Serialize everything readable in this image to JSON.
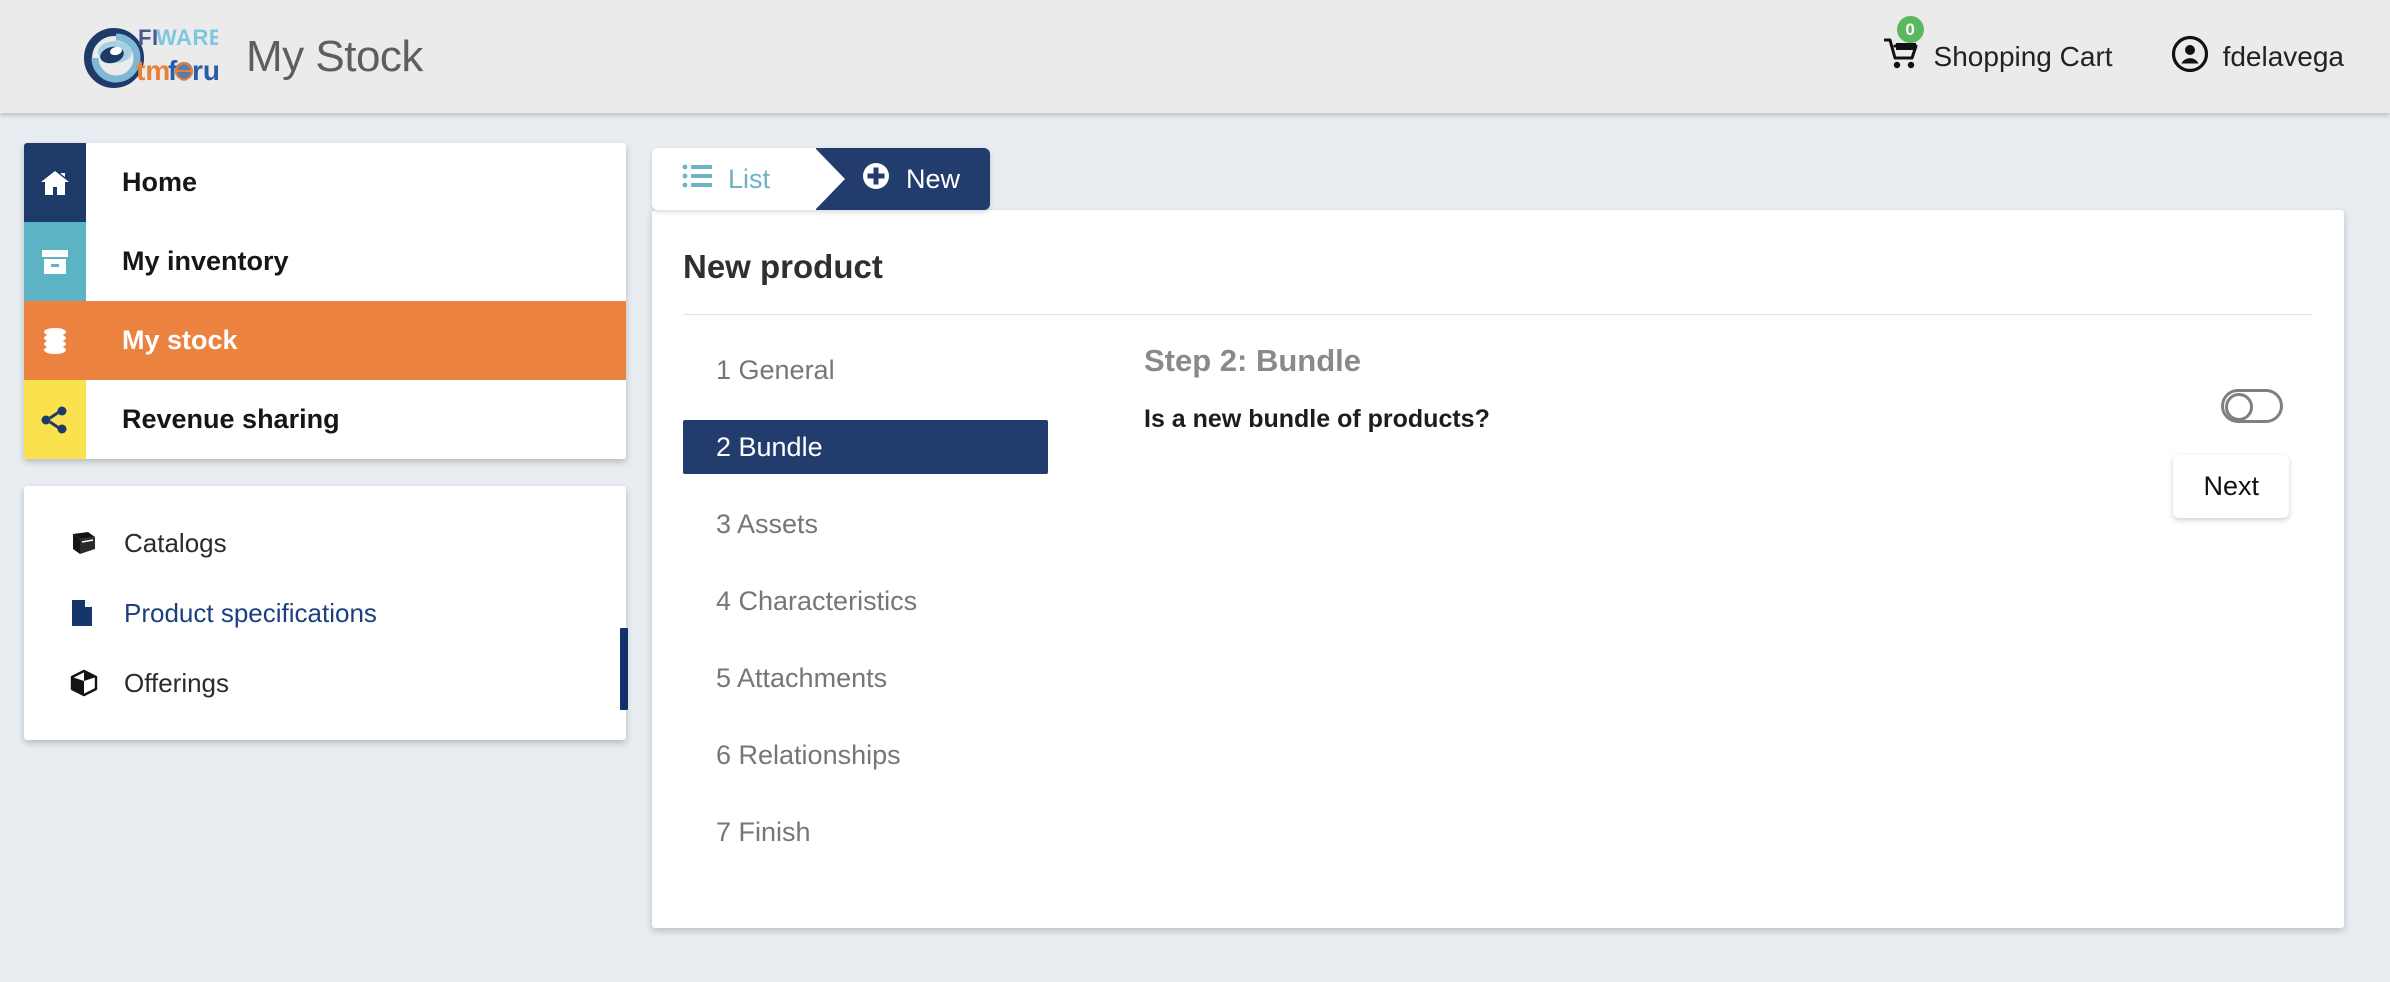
{
  "header": {
    "app_title": "My Stock",
    "logo_alt": "FIWARE tmforum",
    "cart_label": "Shopping Cart",
    "cart_badge": "0",
    "user_label": "fdelavega"
  },
  "sidebar": {
    "nav_items": [
      {
        "label": "Home",
        "icon": "home-icon",
        "color": "#1e3a69",
        "active": false
      },
      {
        "label": "My inventory",
        "icon": "archive-icon",
        "color": "#5cb3c4",
        "active": false
      },
      {
        "label": "My stock",
        "icon": "database-icon",
        "color": "#ec8240",
        "active": true
      },
      {
        "label": "Revenue sharing",
        "icon": "share-icon",
        "color": "#f9e24e",
        "active": false
      }
    ],
    "sub_items": [
      {
        "label": "Catalogs",
        "icon": "book-icon",
        "linked": false
      },
      {
        "label": "Product specifications",
        "icon": "document-icon",
        "linked": true
      },
      {
        "label": "Offerings",
        "icon": "cube-icon",
        "linked": false
      }
    ]
  },
  "tabs": [
    {
      "label": "List",
      "icon": "list-icon",
      "active": false
    },
    {
      "label": "New",
      "icon": "plus-circle-icon",
      "active": true
    }
  ],
  "main": {
    "card_title": "New product",
    "steps": [
      {
        "number": "1",
        "label": "General",
        "active": false
      },
      {
        "number": "2",
        "label": "Bundle",
        "active": true
      },
      {
        "number": "3",
        "label": "Assets",
        "active": false
      },
      {
        "number": "4",
        "label": "Characteristics",
        "active": false
      },
      {
        "number": "5",
        "label": "Attachments",
        "active": false
      },
      {
        "number": "6",
        "label": "Relationships",
        "active": false
      },
      {
        "number": "7",
        "label": "Finish",
        "active": false
      }
    ],
    "step_heading": "Step 2: Bundle",
    "question": "Is a new bundle of products?",
    "bundle_toggle_state": "off",
    "next_label": "Next"
  },
  "colors": {
    "navy": "#223d6d",
    "orange": "#ec8240",
    "teal": "#5cb3c4",
    "yellow": "#f9e24e",
    "badge_green": "#5cb860",
    "page_bg": "#e8edf1",
    "header_bg": "#ebebeb"
  }
}
